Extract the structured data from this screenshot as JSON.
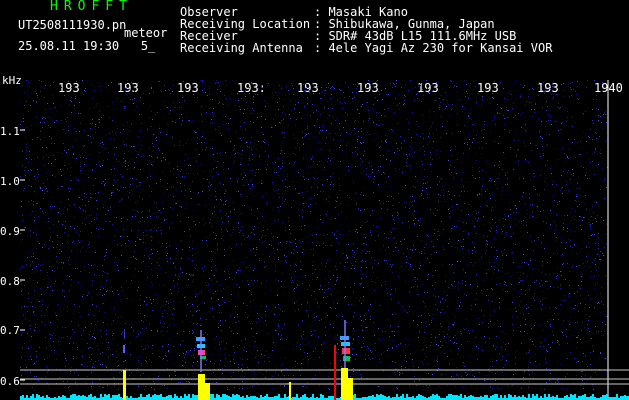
{
  "header": {
    "title": "HROFFT",
    "filename": "UT2508111930.pn",
    "detector": "meteor",
    "datetime": "25.08.11 19:30   5_"
  },
  "info": [
    {
      "key": "Observer",
      "value": ": Masaki Kano"
    },
    {
      "key": "Receiving Location",
      "value": ": Shibukawa, Gunma, Japan"
    },
    {
      "key": "Receiver",
      "value": ": SDR# 43dB L15 111.6MHz USB"
    },
    {
      "key": "Receiving Antenna",
      "value": ": 4ele Yagi Az 230 for Kansai VOR"
    }
  ],
  "axis": {
    "y_unit": "kHz",
    "x_ticks": [
      "193",
      "193",
      "193",
      "193:",
      "193",
      "193",
      "193",
      "193",
      "193",
      "1940"
    ],
    "y_ticks": [
      "1.1",
      "1.0",
      "0.9",
      "0.8",
      "0.7",
      "0.6"
    ]
  },
  "colors": {
    "background": "#000000",
    "noise": "#1a1a8c",
    "title": "#00ff00",
    "bottom_band": "#00e5ff",
    "burst_yellow": "#ffff00",
    "burst_red": "#ff0000",
    "reference_line": "#c8c8c8"
  }
}
